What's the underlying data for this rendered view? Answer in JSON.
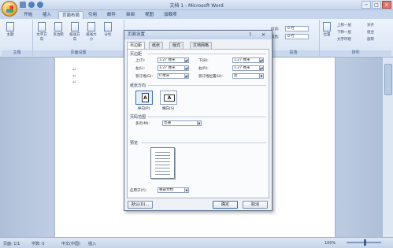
{
  "window": {
    "title": "文档 1 - Microsoft Word",
    "minimize": "─",
    "maximize": "□",
    "close": "✕"
  },
  "ribbon_tabs": [
    "开始",
    "插入",
    "页面布局",
    "引用",
    "邮件",
    "审阅",
    "视图",
    "加载项"
  ],
  "ribbon": {
    "theme_group": {
      "label": "主题",
      "buttons": [
        "主题"
      ]
    },
    "page_setup_group": {
      "label": "页面设置",
      "buttons": [
        "文字方向",
        "页边距",
        "纸张方向",
        "纸张大小",
        "分栏"
      ]
    },
    "paragraph_group": {
      "label": "段落",
      "spacing_before": "0 行",
      "spacing_after": "0 行",
      "before_label": "段前:",
      "after_label": "段后:"
    },
    "arrange_group": {
      "label": "排列",
      "items": [
        "位置",
        "上移一层",
        "下移一层",
        "文字环绕",
        "对齐",
        "组合",
        "旋转"
      ]
    }
  },
  "dialog": {
    "title": "页面设置",
    "help": "?",
    "close": "✕",
    "tabs": [
      "页边距",
      "纸张",
      "版式",
      "文档网格"
    ],
    "margins_section": "页边距",
    "top_label": "上(T):",
    "top_value": "1.27 厘米",
    "bottom_label": "下(B):",
    "bottom_value": "1.27 厘米",
    "left_label": "左(L):",
    "left_value": "1.27 厘米",
    "right_label": "右(R):",
    "right_value": "1.27 厘米",
    "gutter_label": "装订线(G):",
    "gutter_value": "0 厘米",
    "gutter_pos_label": "装订线位置(U):",
    "gutter_pos_value": "左",
    "orientation_section": "纸张方向",
    "portrait_label": "纵向(P)",
    "landscape_label": "横向(S)",
    "pages_section": "页码范围",
    "multi_pages_label": "多页(M):",
    "multi_pages_value": "普通",
    "preview_section": "预览",
    "apply_to_label": "应用于(Y):",
    "apply_to_value": "整篇文档",
    "default_button": "默认(D)...",
    "ok_button": "确定",
    "cancel_button": "取消"
  },
  "document": {
    "para_marks": [
      "↵",
      "↵",
      "↵"
    ]
  },
  "status_bar": {
    "page": "页面: 1/1",
    "words": "字数: 0",
    "language": "中文(中国)",
    "mode": "插入",
    "zoom": "100%"
  }
}
